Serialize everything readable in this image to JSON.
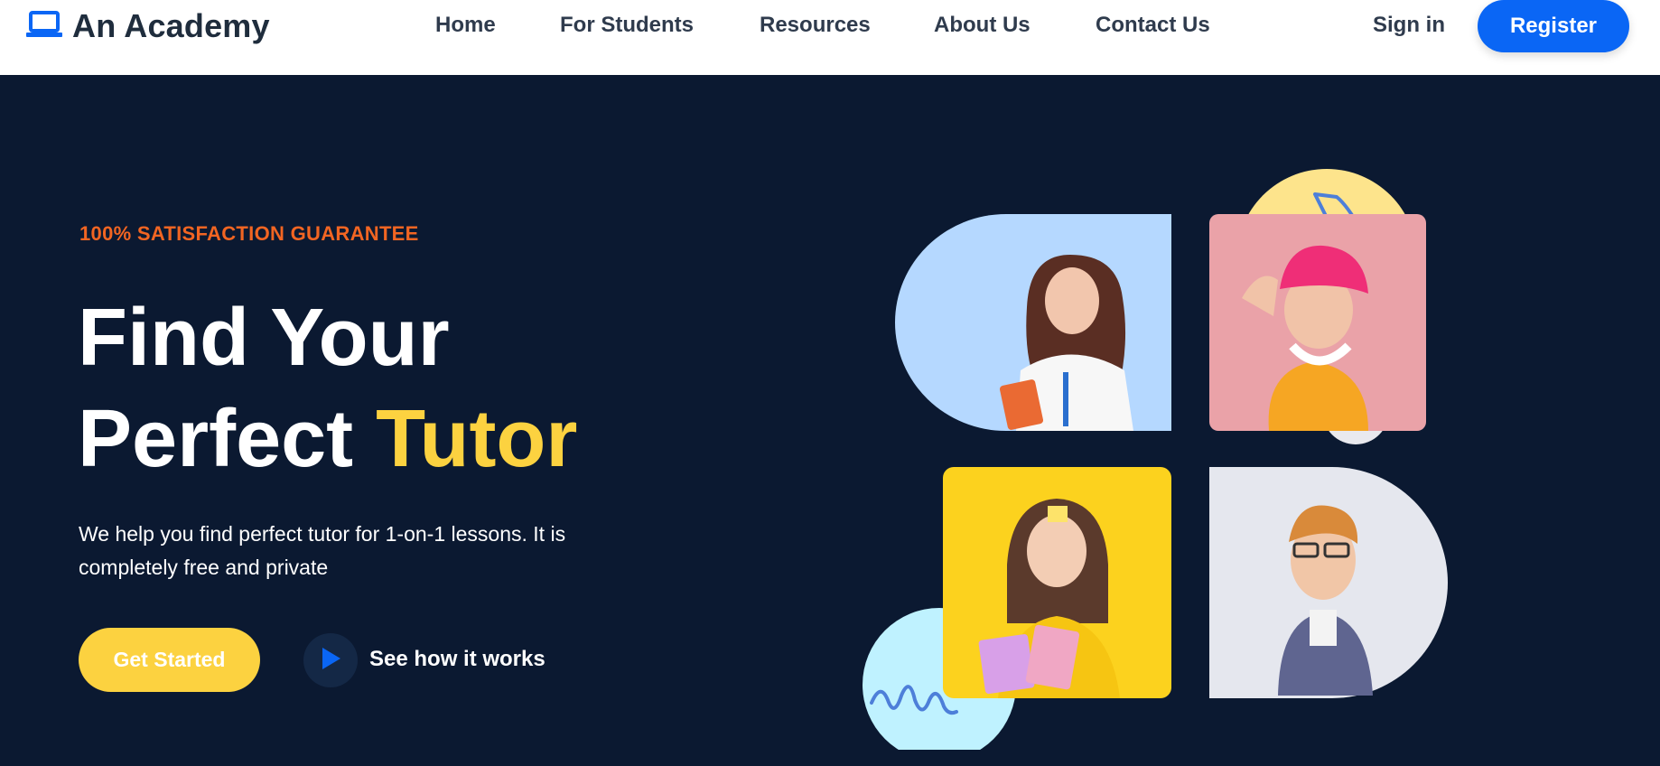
{
  "brand": {
    "name": "An Academy",
    "icon": "laptop-icon"
  },
  "nav": {
    "links": [
      "Home",
      "For Students",
      "Resources",
      "About Us",
      "Contact Us"
    ],
    "signin": "Sign in",
    "register": "Register"
  },
  "hero": {
    "tag": "100% SATISFACTION GUARANTEE",
    "title_line1": "Find Your",
    "title_line2_plain": "Perfect",
    "title_line2_accent": "Tutor",
    "description": "We help you find perfect tutor for 1-on-1 lessons. It is completely free and private",
    "primary_cta": "Get Started",
    "secondary_cta": "See how it works",
    "secondary_icon": "play-icon"
  },
  "colors": {
    "brand_blue": "#0a66f5",
    "hero_bg": "#0b1931",
    "accent_yellow": "#fcd240",
    "tag_orange": "#f26522"
  }
}
